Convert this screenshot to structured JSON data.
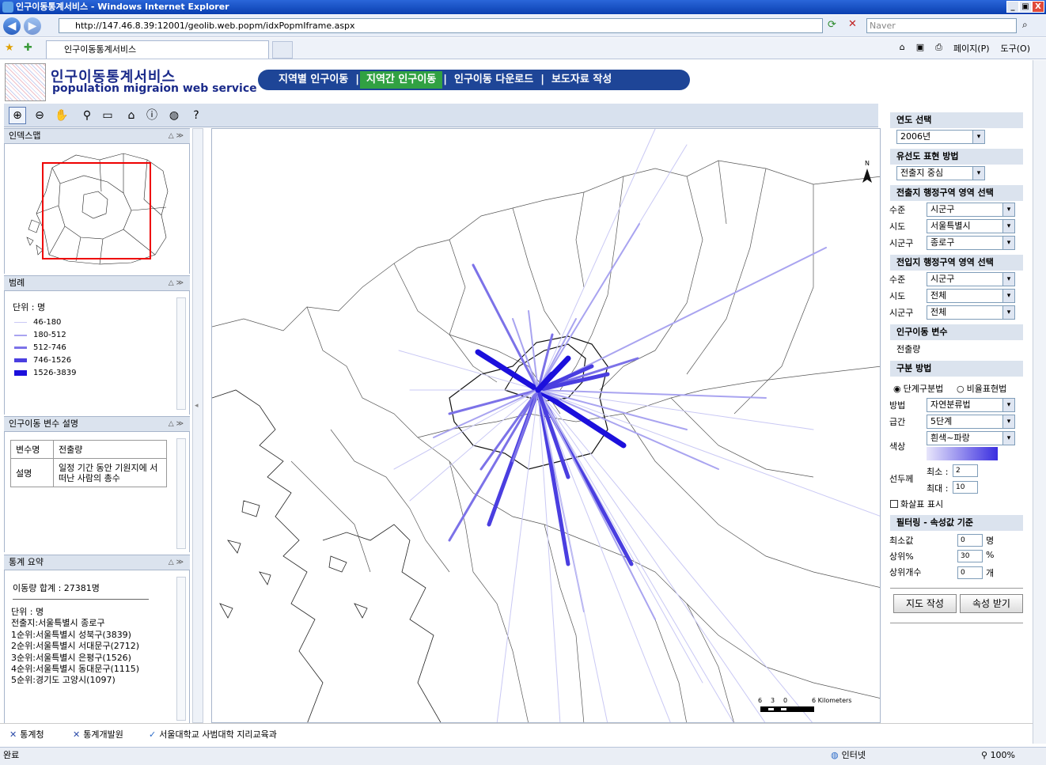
{
  "window": {
    "title": "인구이동통계서비스 - Windows Internet Explorer",
    "min": "_",
    "max": "▣",
    "close": "X"
  },
  "browser": {
    "url": "http://147.46.8.39:12001/geolib.web.popm/idxPopmIframe.aspx",
    "search_placeholder": "Naver",
    "tab_label": "인구이동통계서비스",
    "page_menu": "페이지(P)",
    "tools_menu": "도구(O)"
  },
  "header": {
    "brand_ko": "인구이동통계서비스",
    "brand_en": "population migraion web service",
    "nav": [
      "지역별 인구이동",
      "지역간 인구이동",
      "인구이동 다운로드",
      "보도자료 작성"
    ],
    "nav_sep": "|",
    "active_index": 1
  },
  "toolbar": {
    "icons": [
      "zoom-in-icon",
      "zoom-out-icon",
      "pan-hand-icon",
      "identify-icon",
      "zoom-box-icon",
      "home-icon",
      "info-icon",
      "globe-icon",
      "help-icon"
    ]
  },
  "index_map": {
    "title": "인덱스맵"
  },
  "legend": {
    "title": "범례",
    "unit": "단위 : 명",
    "items": [
      {
        "label": "46-180",
        "color": "#c9c8f4",
        "width": 1
      },
      {
        "label": "180-512",
        "color": "#a9a4f0",
        "width": 2
      },
      {
        "label": "512-746",
        "color": "#7c72e8",
        "width": 3
      },
      {
        "label": "746-1526",
        "color": "#4a3ee0",
        "width": 5
      },
      {
        "label": "1526-3839",
        "color": "#1c10dc",
        "width": 7
      }
    ]
  },
  "variable_desc": {
    "title": "인구이동 변수 설명",
    "rows": [
      {
        "key": "변수명",
        "value": "전출량"
      },
      {
        "key": "설명",
        "value": "일정 기간 동안 기원지에 서 떠난 사람의 총수"
      }
    ]
  },
  "stats": {
    "title": "통계 요약",
    "total": "이동량 합계 : 27381명",
    "unit": "단위 : 명",
    "origin": "전출지:서울특별시 종로구",
    "ranks": [
      "1순위:서울특별시 성북구(3839)",
      "2순위:서울특별시 서대문구(2712)",
      "3순위:서울특별시 은평구(1526)",
      "4순위:서울특별시 동대문구(1115)",
      "5순위:경기도 고양시(1097)"
    ]
  },
  "map": {
    "scale_labels": [
      "6",
      "3",
      "0",
      "6 Kilometers"
    ],
    "north": "N"
  },
  "right_panel": {
    "year": {
      "title": "연도 선택",
      "value": "2006년"
    },
    "flow_method": {
      "title": "유선도 표현 방법",
      "value": "전출지 중심"
    },
    "origin": {
      "title": "전출지 행정구역 영역 선택",
      "level_label": "수준",
      "level": "시군구",
      "sido_label": "시도",
      "sido": "서울특별시",
      "sigungu_label": "시군구",
      "sigungu": "종로구"
    },
    "dest": {
      "title": "전입지 행정구역 영역 선택",
      "level_label": "수준",
      "level": "시군구",
      "sido_label": "시도",
      "sido": "전체",
      "sigungu_label": "시군구",
      "sigungu": "전체"
    },
    "variable": {
      "title": "인구이동 변수",
      "value": "전출량"
    },
    "classify": {
      "title": "구분 방법",
      "radio1": "단계구분법",
      "radio2": "비율표현법",
      "method_label": "방법",
      "method": "자연분류법",
      "grade_label": "급간",
      "grade": "5단계",
      "color_label": "색상",
      "color": "흰색~파랑",
      "width_label": "선두께",
      "min_label": "최소 :",
      "min": "2",
      "max_label": "최대 :",
      "max": "10",
      "arrow_label": "화살표 표시"
    },
    "filter": {
      "title": "필터링 - 속성값 기준",
      "min_label": "최소값",
      "min": "0",
      "min_unit": "명",
      "top_pct_label": "상위%",
      "top_pct": "30",
      "top_pct_unit": "%",
      "top_n_label": "상위개수",
      "top_n": "0",
      "top_n_unit": "개"
    },
    "buttons": {
      "draw": "지도 작성",
      "attr": "속성 받기"
    }
  },
  "footer": {
    "logos": [
      "통계청",
      "통계개발원",
      "서울대학교 사범대학 지리교육과"
    ]
  },
  "status": {
    "left": "완료",
    "zone": "인터넷",
    "zoom": "100%"
  }
}
